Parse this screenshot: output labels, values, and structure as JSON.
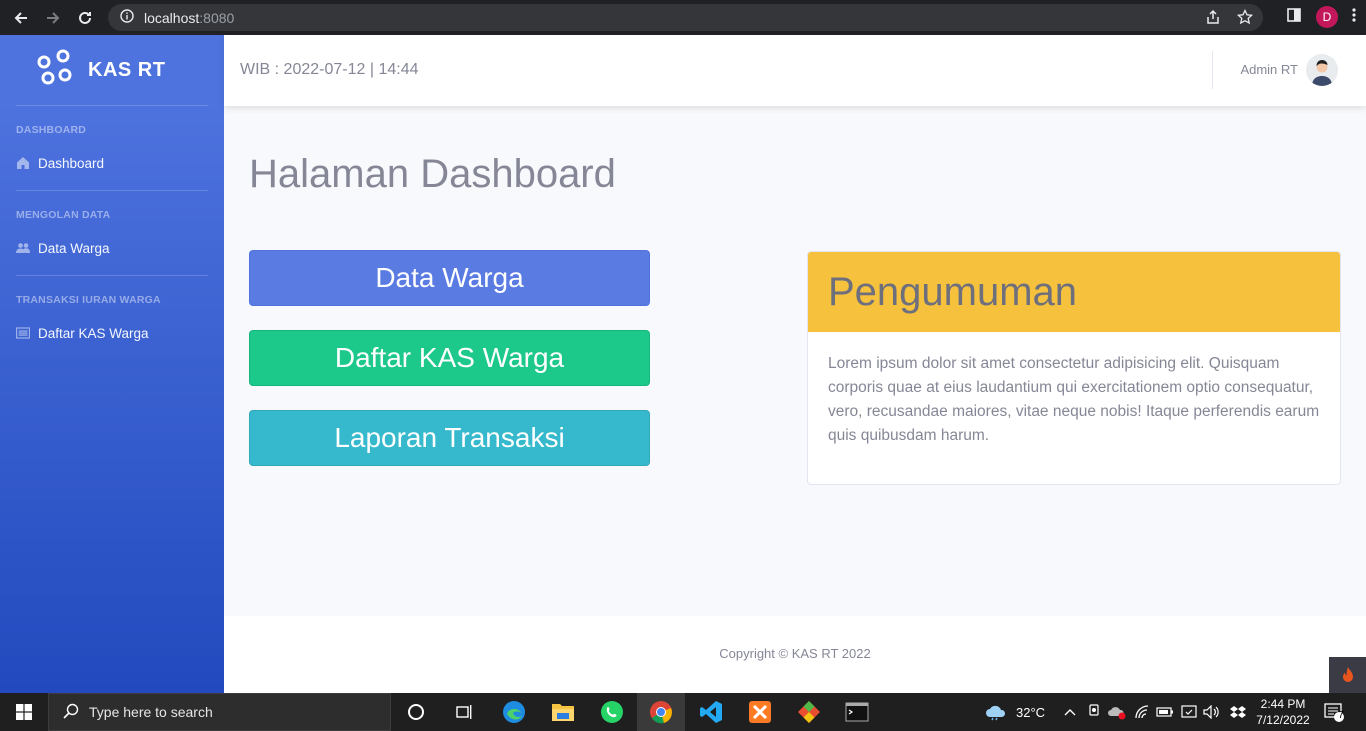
{
  "browser": {
    "url_host": "localhost",
    "url_port": ":8080",
    "profile_initial": "D"
  },
  "sidebar": {
    "brand": "KAS RT",
    "sections": [
      {
        "heading": "DASHBOARD",
        "item": "Dashboard",
        "icon": "home-icon"
      },
      {
        "heading": "MENGOLAN DATA",
        "item": "Data Warga",
        "icon": "users-icon"
      },
      {
        "heading": "TRANSAKSI IURAN WARGA",
        "item": "Daftar KAS Warga",
        "icon": "list-icon"
      }
    ]
  },
  "topbar": {
    "datetime": "WIB : 2022-07-12 | 14:44",
    "user_name": "Admin RT"
  },
  "main": {
    "title": "Halaman Dashboard",
    "buttons": {
      "data_warga": "Data Warga",
      "daftar_kas": "Daftar KAS Warga",
      "laporan": "Laporan Transaksi"
    },
    "announcement": {
      "title": "Pengumuman",
      "body": "Lorem ipsum dolor sit amet consectetur adipisicing elit. Quisquam corporis quae at eius laudantium qui exercitationem optio consequatur, vero, recusandae maiores, vitae neque nobis! Itaque perferendis earum quis quibusdam harum."
    }
  },
  "footer": {
    "copyright": "Copyright © KAS RT 2022"
  },
  "taskbar": {
    "search_placeholder": "Type here to search",
    "temperature": "32°C",
    "time": "2:44 PM",
    "date": "7/12/2022",
    "notification_count": "7"
  },
  "colors": {
    "primary": "#4e73df",
    "success": "#1cc88a",
    "info": "#36b9cc",
    "warning": "#f6c23e"
  }
}
